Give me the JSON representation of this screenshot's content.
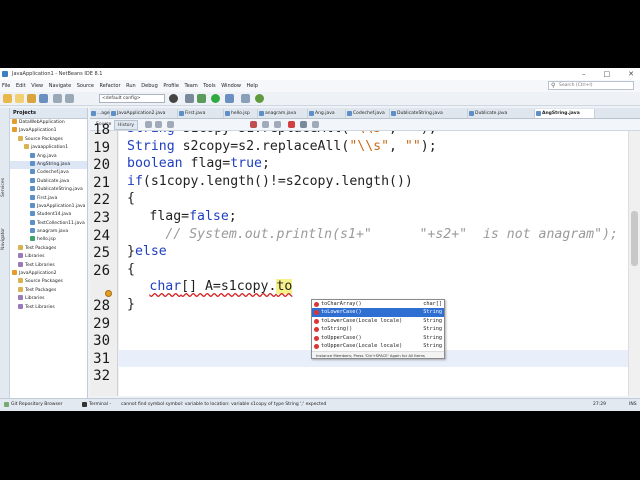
{
  "window": {
    "title": "JavaApplication1 - NetBeans IDE 8.1",
    "buttons": [
      "–",
      "□",
      "✕"
    ]
  },
  "menu": [
    "File",
    "Edit",
    "View",
    "Navigate",
    "Source",
    "Refactor",
    "Run",
    "Debug",
    "Profile",
    "Team",
    "Tools",
    "Window",
    "Help"
  ],
  "search": {
    "placeholder": "Search (Ctrl+I)"
  },
  "toolbar": {
    "config": "<default config>"
  },
  "left_strip": {
    "projects": "Projects",
    "navigator": "Navigator",
    "services": "Services"
  },
  "projects_panel": {
    "tabs": [
      "Projects",
      "Files",
      "Services"
    ],
    "tree": [
      {
        "label": "DataWebApplication",
        "icon": "project-icon",
        "indent": 0
      },
      {
        "label": "JavaApplication1",
        "icon": "project-icon",
        "indent": 0
      },
      {
        "label": "Source Packages",
        "icon": "package-icon",
        "indent": 1
      },
      {
        "label": "javaapplication1",
        "icon": "package-icon",
        "indent": 2
      },
      {
        "label": "Ang.java",
        "icon": "java-file-icon",
        "indent": 3
      },
      {
        "label": "AngString.java",
        "icon": "java-file-icon",
        "indent": 3
      },
      {
        "label": "Codechef.java",
        "icon": "java-file-icon",
        "indent": 3
      },
      {
        "label": "Dublicate.java",
        "icon": "java-file-icon",
        "indent": 3
      },
      {
        "label": "DublicateString.java",
        "icon": "java-file-icon",
        "indent": 3
      },
      {
        "label": "First.java",
        "icon": "java-file-icon",
        "indent": 3
      },
      {
        "label": "JavaApplication1.java",
        "icon": "java-file-icon",
        "indent": 3
      },
      {
        "label": "Student14.java",
        "icon": "java-file-icon",
        "indent": 3
      },
      {
        "label": "TestCollection11.java",
        "icon": "java-file-icon",
        "indent": 3
      },
      {
        "label": "anagram.java",
        "icon": "java-file-icon",
        "indent": 3
      },
      {
        "label": "hello.jsp",
        "icon": "jsp-file-icon",
        "indent": 3
      },
      {
        "label": "Test Packages",
        "icon": "package-icon",
        "indent": 1
      },
      {
        "label": "Libraries",
        "icon": "library-icon",
        "indent": 1
      },
      {
        "label": "Test Libraries",
        "icon": "library-icon",
        "indent": 1
      },
      {
        "label": "JavaApplication2",
        "icon": "project-icon",
        "indent": 0
      },
      {
        "label": "Source Packages",
        "icon": "package-icon",
        "indent": 1
      },
      {
        "label": "Test Packages",
        "icon": "package-icon",
        "indent": 1
      },
      {
        "label": "Libraries",
        "icon": "library-icon",
        "indent": 1
      },
      {
        "label": "Test Libraries",
        "icon": "library-icon",
        "indent": 1
      }
    ]
  },
  "editor_tabs": [
    {
      "label": "...age",
      "active": false
    },
    {
      "label": "JavaApplication2.java",
      "active": false
    },
    {
      "label": "First.java",
      "active": false
    },
    {
      "label": "hello.jsp",
      "active": false
    },
    {
      "label": "anagram.java",
      "active": false
    },
    {
      "label": "Ang.java",
      "active": false
    },
    {
      "label": "Codechef.java",
      "active": false
    },
    {
      "label": "DublicateString.java",
      "active": false
    },
    {
      "label": "Dublicate.java",
      "active": false
    },
    {
      "label": "AngString.java",
      "active": true
    }
  ],
  "editor_toolbar": {
    "source": "Source",
    "history": "History"
  },
  "code_lines": [
    {
      "num": "18",
      "text": "String s1copy=s1.replaceAll(\"\\\\s\", \"\");"
    },
    {
      "num": "19",
      "text": "String s2copy=s2.replaceAll(\"\\\\s\", \"\");"
    },
    {
      "num": "20",
      "text": "boolean flag=true;"
    },
    {
      "num": "21",
      "text": "if(s1copy.length()!=s2copy.length())"
    },
    {
      "num": "22",
      "text": "{"
    },
    {
      "num": "23",
      "text": "flag=false;"
    },
    {
      "num": "24",
      "text": "// System.out.println(s1+\"      \"+s2+\"  is not anagram\");"
    },
    {
      "num": "25",
      "text": "}else"
    },
    {
      "num": "26",
      "text": "{"
    },
    {
      "num": "",
      "text": "char[] A=s1copy.to"
    },
    {
      "num": "28",
      "text": "}"
    },
    {
      "num": "29",
      "text": ""
    },
    {
      "num": "30",
      "text": ""
    },
    {
      "num": "31",
      "text": ""
    },
    {
      "num": "32",
      "text": ""
    }
  ],
  "completion_popup": {
    "items": [
      {
        "method": "toCharArray()",
        "ret": "char[]",
        "selected": false
      },
      {
        "method": "toLowerCase()",
        "ret": "String",
        "selected": true
      },
      {
        "method": "toLowerCase(Locale locale)",
        "ret": "String",
        "selected": false
      },
      {
        "method": "toString()",
        "ret": "String",
        "selected": false
      },
      {
        "method": "toUpperCase()",
        "ret": "String",
        "selected": false
      },
      {
        "method": "toUpperCase(Locale locale)",
        "ret": "String",
        "selected": false
      }
    ],
    "footer": "Instance Members; Press 'Ctrl+SPACE' Again for All Items"
  },
  "bottom": {
    "git": "Git Repository Browser",
    "terminal": "Terminal -",
    "error": "cannot find symbol  symbol:  variable to  location: variable s1copy of type String  ';' expected",
    "position": "27:29",
    "mode": "INS"
  },
  "colors": {
    "keyword": "#1f3fbf",
    "string": "#c86c1a",
    "comment": "#9a9a9a",
    "selection": "#2f6fd1",
    "highlight": "#f6f18a"
  }
}
